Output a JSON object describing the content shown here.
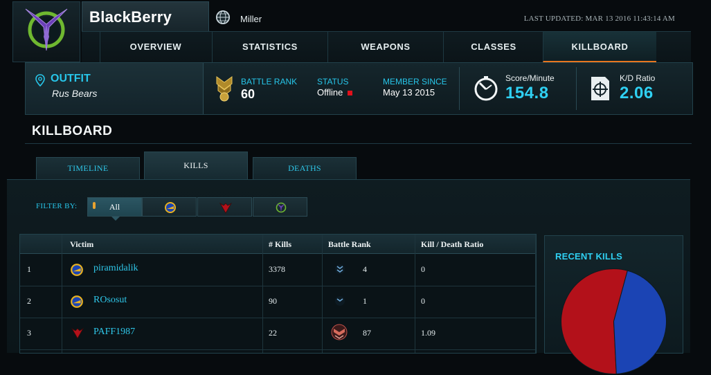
{
  "header": {
    "player_name": "BlackBerry",
    "server": "Miller",
    "last_updated": "LAST UPDATED: MAR 13 2016 11:43:14 AM",
    "faction_icon": "vanu-sovereignty-icon"
  },
  "nav": {
    "items": [
      {
        "label": "OVERVIEW"
      },
      {
        "label": "STATISTICS"
      },
      {
        "label": "WEAPONS"
      },
      {
        "label": "CLASSES"
      },
      {
        "label": "KILLBOARD"
      }
    ],
    "active": "KILLBOARD"
  },
  "info": {
    "outfit_label": "OUTFIT",
    "outfit_name": "Rus Bears",
    "battle_rank_label": "BATTLE RANK",
    "battle_rank": "60",
    "status_label": "STATUS",
    "status": "Offline",
    "member_since_label": "MEMBER SINCE",
    "member_since": "May 13 2015",
    "score_minute_label": "Score/Minute",
    "score_minute": "154.8",
    "kd_label": "K/D Ratio",
    "kd": "2.06",
    "status_color": "#e0111b"
  },
  "section": {
    "title": "KILLBOARD",
    "tabs": [
      {
        "label": "TIMELINE"
      },
      {
        "label": "KILLS"
      },
      {
        "label": "DEATHS"
      }
    ],
    "active_tab": "KILLS"
  },
  "filter": {
    "label": "FILTER BY:",
    "options": [
      {
        "label": "All",
        "icon": "nanite-icon"
      },
      {
        "label": "",
        "icon": "new-conglomerate-icon"
      },
      {
        "label": "",
        "icon": "terran-republic-icon"
      },
      {
        "label": "",
        "icon": "vanu-sovereignty-icon"
      }
    ]
  },
  "table": {
    "headers": [
      "Victim",
      "# Kills",
      "Battle Rank",
      "Kill / Death Ratio"
    ],
    "rows": [
      {
        "index": "1",
        "victim": "piramidalik",
        "kills": "3378",
        "battle_rank": "4",
        "kd": "0",
        "faction": "new-conglomerate-icon"
      },
      {
        "index": "2",
        "victim": "ROsosut",
        "kills": "90",
        "battle_rank": "1",
        "kd": "0",
        "faction": "new-conglomerate-icon"
      },
      {
        "index": "3",
        "victim": "PAFF1987",
        "kills": "22",
        "battle_rank": "87",
        "kd": "1.09",
        "faction": "terran-republic-icon"
      }
    ]
  },
  "recent_kills": {
    "title": "RECENT KILLS",
    "pie": [
      {
        "label": "",
        "value": 55,
        "color": "#b3111a"
      },
      {
        "label": "",
        "value": 45,
        "color": "#1b44b4"
      }
    ]
  },
  "colors": {
    "accent_cyan": "#2fd0f2",
    "active_nav_underline": "#e8761f",
    "nc_blue": "#1b44b4",
    "tr_red": "#b3111a",
    "vs_purple": "#6a3fb5"
  }
}
